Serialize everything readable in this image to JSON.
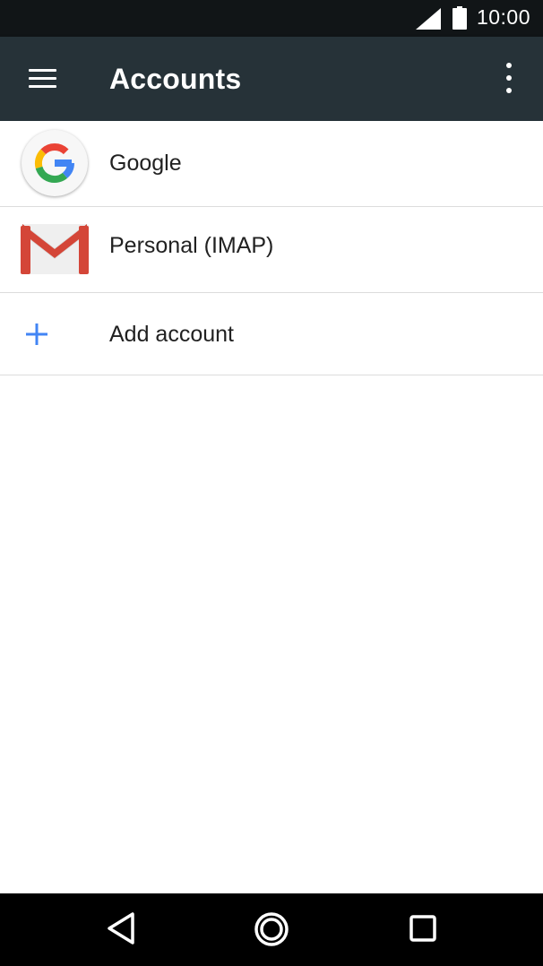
{
  "status_bar": {
    "time": "10:00",
    "signal_icon": "cellular-signal-icon",
    "battery_icon": "battery-full-icon"
  },
  "app_bar": {
    "title": "Accounts",
    "menu_icon": "hamburger-menu-icon",
    "overflow_icon": "more-vert-icon",
    "background": "#263238"
  },
  "accounts": [
    {
      "label": "Google",
      "icon": "google-g-icon"
    },
    {
      "label": "Personal (IMAP)",
      "icon": "gmail-m-icon"
    }
  ],
  "add_account": {
    "label": "Add account",
    "icon": "plus-icon",
    "icon_color": "#4285f4"
  },
  "nav_bar": {
    "back_icon": "back-triangle-icon",
    "home_icon": "home-circle-icon",
    "recents_icon": "recents-square-icon"
  }
}
